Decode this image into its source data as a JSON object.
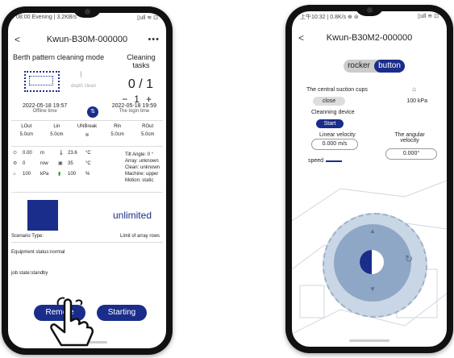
{
  "phone1": {
    "status_left": "08:00 Evening | 3.2KB/s",
    "status_right": "▯ull ≋ ⊡",
    "title": "Kwun-B30M-000000",
    "back": "<",
    "more": "•••",
    "mode": "Berth pattern cleaning mode",
    "tasks_label": "Cleaning tasks",
    "depth_clean": "depth clean",
    "counter": "0 / 1",
    "stepper_minus": "−",
    "stepper_value": "1",
    "stepper_plus": "+",
    "offline_time": "2022-05-18 19:57",
    "offline_label": "Offline time",
    "login_time": "2022-05-18 19:59",
    "login_label": "The login time",
    "grid_headers": [
      "LOut",
      "Lin",
      "UNBreak",
      "Rln",
      "ROut"
    ],
    "grid_values": [
      "5.0cm",
      "5.0cm",
      "≋",
      "5.0cm",
      "5.0cm"
    ],
    "env": [
      {
        "icon": "⊙",
        "value": "0.00",
        "unit": "m",
        "icon2": "🌡",
        "value2": "23.6",
        "unit2": "°C"
      },
      {
        "icon": "⚙",
        "value": "0",
        "unit": "row",
        "icon2": "▣",
        "value2": "35",
        "unit2": "°C"
      },
      {
        "icon": "⌂",
        "value": "100",
        "unit": "kPa",
        "icon2": "▮",
        "value2": "100",
        "unit2": "%"
      }
    ],
    "machine_lines": [
      "Tilt Angle: 0  °",
      "Array: unknown",
      "Clean: unknown",
      "Machine: upper",
      "Motion: static"
    ],
    "unlimited": "unlimited",
    "scenario_type": "Scenario Type:",
    "limit_rows": "Limit of array rows",
    "equipment_status": "Equipment status:normal",
    "job_state": "job state:standby",
    "remote": "Remote",
    "starting": "Starting"
  },
  "phone2": {
    "status_left": "上午10:32 | 0.8K/s ⊕ ⊜",
    "status_right": "▯ull ≋ ⊡",
    "title": "Kwun-B30M2-000000",
    "back": "<",
    "toggle_rocker": "rocker",
    "toggle_button": "button",
    "suction_label": "The central suction cups",
    "close": "close",
    "pressure": "100   kPa",
    "clean_device": "Cleanning device",
    "start": "Start",
    "linear_label": "Linear velocity",
    "linear_value": "0.000 m/s",
    "angular_label": "The angular velocity",
    "angular_value": "0.000°",
    "speed": "speed"
  }
}
